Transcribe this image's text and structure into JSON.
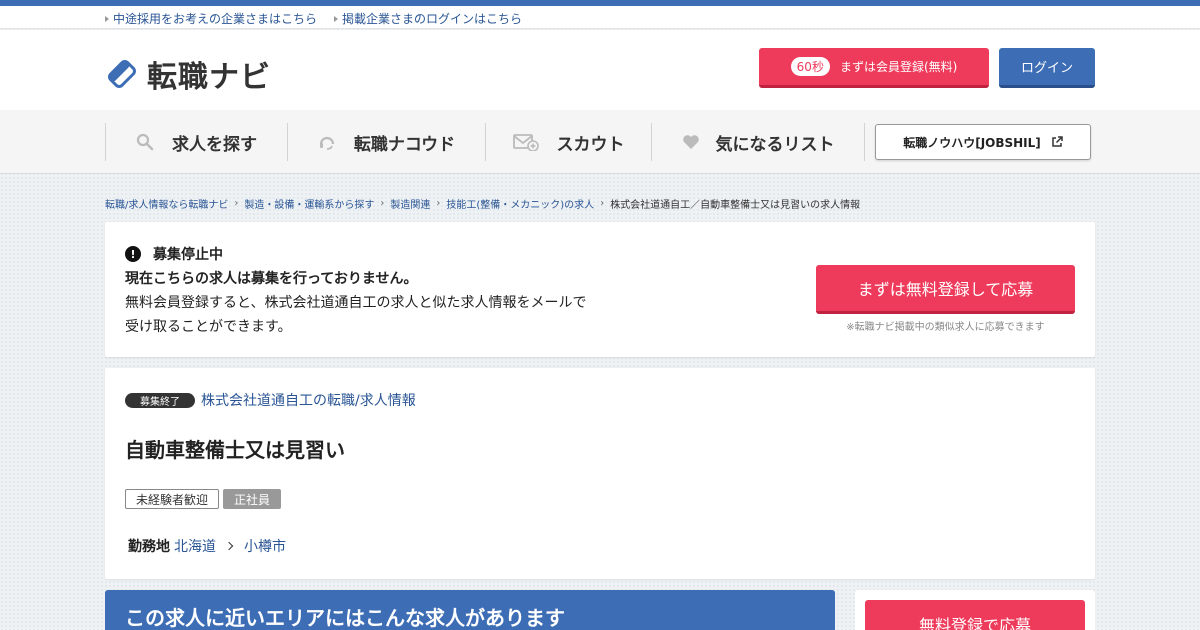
{
  "top_links": [
    {
      "label": "中途採用をお考えの企業さまはこちら"
    },
    {
      "label": "掲載企業さまのログインはこちら"
    }
  ],
  "header": {
    "logo_text": "転職ナビ",
    "register_badge": "60秒",
    "register_label": "まずは会員登録(無料)",
    "login_label": "ログイン"
  },
  "nav": {
    "items": [
      {
        "label": "求人を探す",
        "icon": "search-icon"
      },
      {
        "label": "転職ナコウド",
        "icon": "headset-icon"
      },
      {
        "label": "スカウト",
        "icon": "mail-plus-icon"
      },
      {
        "label": "気になるリスト",
        "icon": "heart-icon"
      }
    ],
    "jobshil_label": "転職ノウハウ[JOBSHIL]"
  },
  "breadcrumb": [
    "転職/求人情報なら転職ナビ",
    "製造・設備・運輸系から探す",
    "製造関連",
    "技能工(整備・メカニック)の求人",
    "株式会社道通自工／自動車整備士又は見習いの求人情報"
  ],
  "notice": {
    "title": "募集停止中",
    "bold_line": "現在こちらの求人は募集を行っておりません。",
    "body": "無料会員登録すると、株式会社道通自工の求人と似た求人情報をメールで受け取ることができます。",
    "apply_label": "まずは無料登録して応募",
    "apply_note": "※転職ナビ掲載中の類似求人に応募できます"
  },
  "job": {
    "status_badge": "募集終了",
    "company_link": "株式会社道通自工の転職/求人情報",
    "title": "自動車整備士又は見習い",
    "tags": [
      "未経験者歓迎",
      "正社員"
    ],
    "location_label": "勤務地",
    "prefecture": "北海道",
    "city": "小樽市"
  },
  "near": {
    "title": "この求人に近いエリアにはこんな求人があります"
  },
  "side": {
    "apply_label": "無料登録で応募"
  },
  "colors": {
    "brand_blue": "#3d6db5",
    "accent_red": "#ee3b5b",
    "link": "#2a5595"
  }
}
